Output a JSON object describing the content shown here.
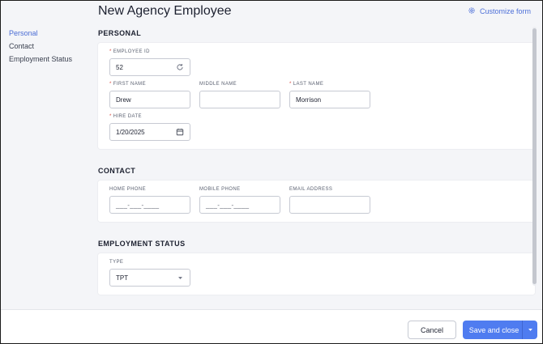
{
  "page": {
    "title": "New Agency Employee",
    "customize_label": "Customize form"
  },
  "sidenav": {
    "items": [
      "Personal",
      "Contact",
      "Employment Status"
    ],
    "active_index": 0
  },
  "sections": {
    "personal": {
      "title": "PERSONAL",
      "employee_id": {
        "label": "EMPLOYEE ID",
        "value": "52"
      },
      "first_name": {
        "label": "FIRST NAME",
        "value": "Drew"
      },
      "middle_name": {
        "label": "MIDDLE NAME",
        "value": ""
      },
      "last_name": {
        "label": "LAST NAME",
        "value": "Morrison"
      },
      "hire_date": {
        "label": "HIRE DATE",
        "value": "1/20/2025"
      }
    },
    "contact": {
      "title": "CONTACT",
      "home_phone": {
        "label": "HOME PHONE",
        "placeholder": "___-___-____"
      },
      "mobile_phone": {
        "label": "MOBILE PHONE",
        "placeholder": "___-___-____"
      },
      "email": {
        "label": "EMAIL ADDRESS",
        "value": ""
      }
    },
    "employment": {
      "title": "EMPLOYMENT STATUS",
      "type": {
        "label": "TYPE",
        "value": "TPT"
      }
    }
  },
  "footer": {
    "cancel_label": "Cancel",
    "save_label": "Save and close"
  },
  "colors": {
    "accent": "#4f7cf0",
    "required": "#d8463b",
    "nav_active": "#4a6cd4"
  },
  "icons": {
    "customize": "gear-icon",
    "refresh": "refresh-icon",
    "calendar": "calendar-icon",
    "dropdown": "chevron-down-icon"
  }
}
